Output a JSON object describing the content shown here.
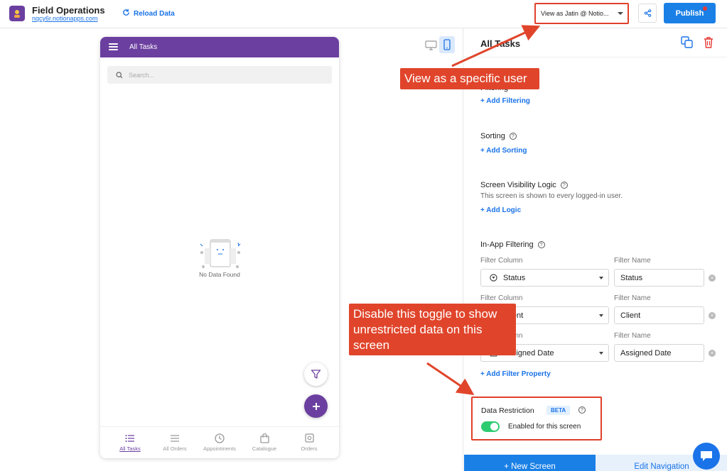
{
  "topbar": {
    "app_title": "Field Operations",
    "app_url": "nqcy6r.notionapps.com",
    "reload_label": "Reload Data",
    "view_as_label": "View as Jatin @ Notio...",
    "publish_label": "Publish"
  },
  "phone": {
    "header_title": "All Tasks",
    "search_placeholder": "Search...",
    "empty_text": "No Data Found",
    "nav": [
      {
        "label": "All Tasks",
        "icon": "list-icon",
        "active": true
      },
      {
        "label": "All Orders",
        "icon": "lines-icon",
        "active": false
      },
      {
        "label": "Appointments",
        "icon": "clock-icon",
        "active": false
      },
      {
        "label": "Catalogue",
        "icon": "bag-icon",
        "active": false
      },
      {
        "label": "Orders",
        "icon": "box-icon",
        "active": false
      }
    ]
  },
  "panel": {
    "title": "All Tasks",
    "filtering_label": "Filtering",
    "add_filtering": "+ Add Filtering",
    "sorting_label": "Sorting",
    "add_sorting": "+ Add Sorting",
    "visibility_label": "Screen Visibility Logic",
    "visibility_text": "This screen is shown to every logged-in user.",
    "add_logic": "+ Add Logic",
    "inapp_label": "In-App Filtering",
    "filter_column_label": "Filter Column",
    "filter_name_label": "Filter Name",
    "filters": [
      {
        "column": "Status",
        "name": "Status"
      },
      {
        "column": "Client",
        "name": "Client"
      },
      {
        "column": "Assigned Date",
        "name": "Assigned Date"
      }
    ],
    "add_filter_property": "+ Add Filter Property",
    "restriction_title": "Data Restriction",
    "beta_label": "BETA",
    "toggle_label": "Enabled for this screen",
    "toggle_enabled": true,
    "new_screen_label": "+  New Screen",
    "edit_nav_label": "Edit Navigation"
  },
  "callouts": {
    "view_as": "View as a specific user",
    "disable_toggle": "Disable this toggle to show unrestricted data on this screen"
  },
  "colors": {
    "brand_purple": "#6b3fa0",
    "accent_blue": "#1a80e6",
    "callout_red": "#e0452b",
    "toggle_green": "#2ecc71"
  }
}
